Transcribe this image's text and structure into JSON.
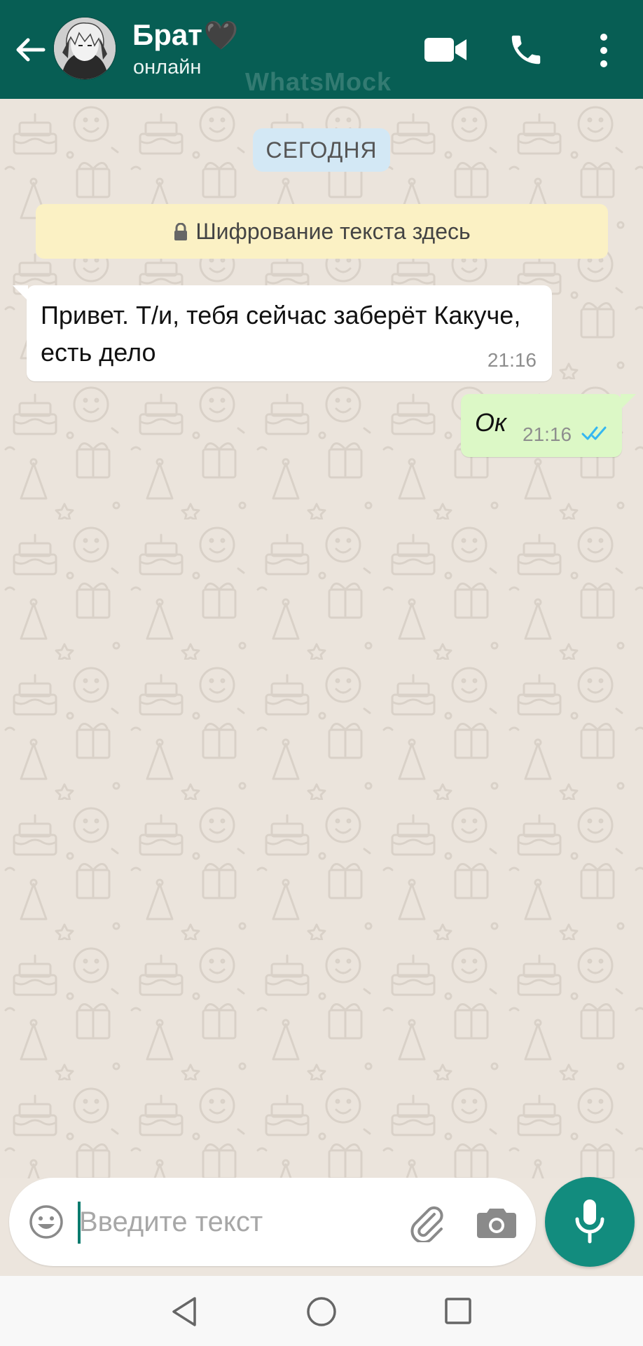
{
  "header": {
    "contact_name": "Брат",
    "contact_emoji": "🖤",
    "status": "онлайн",
    "watermark": "WhatsMock",
    "icons": [
      "back-arrow-icon",
      "avatar",
      "video-call-icon",
      "phone-icon",
      "more-vert-icon"
    ]
  },
  "chat": {
    "date_label": "СЕГОДНЯ",
    "encryption_notice": "Шифрование текста здесь",
    "messages": [
      {
        "direction": "incoming",
        "text": "Привет. Т/и, тебя сейчас заберёт Какуче, есть дело",
        "time": "21:16"
      },
      {
        "direction": "outgoing",
        "text": "Ок",
        "time": "21:16",
        "status": "read-double-tick"
      }
    ]
  },
  "composer": {
    "placeholder": "Введите текст",
    "value": "",
    "icons": [
      "emoji-icon",
      "attach-paperclip-icon",
      "camera-icon",
      "microphone-icon"
    ]
  },
  "colors": {
    "header_bg": "#075e54",
    "chat_bg": "#ebe4dc",
    "incoming_bubble": "#ffffff",
    "outgoing_bubble": "#dcf8c6",
    "read_ticks": "#34b7f1",
    "mic_button": "#128c7e",
    "date_pill": "#d3e8f5",
    "notice_bg": "#fbf1c4"
  },
  "navbar": {
    "icons": [
      "nav-back-icon",
      "nav-home-icon",
      "nav-recents-icon"
    ]
  }
}
